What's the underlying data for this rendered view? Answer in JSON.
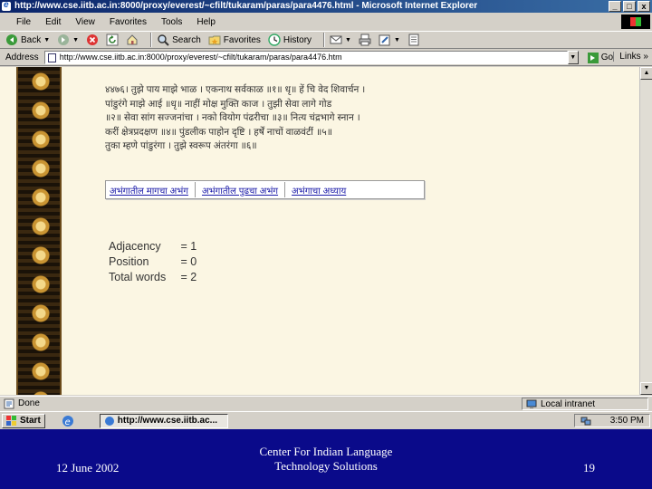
{
  "window": {
    "title": "http://www.cse.iitb.ac.in:8000/proxy/everest/~cfilt/tukaram/paras/para4476.html - Microsoft Internet Explorer",
    "minimize": "_",
    "maximize": "□",
    "close": "x"
  },
  "menu": [
    "File",
    "Edit",
    "View",
    "Favorites",
    "Tools",
    "Help"
  ],
  "toolbar": {
    "back": "Back",
    "search": "Search",
    "favorites": "Favorites",
    "history": "History"
  },
  "address": {
    "label": "Address",
    "url": "http://www.cse.iitb.ac.in:8000/proxy/everest/~cfilt/tukaram/paras/para4476.htm",
    "go": "Go",
    "links": "Links"
  },
  "content": {
    "gujarati_lines": [
      "४४७६। तुझे पाय माझे भाळ । एकनाथ सर्वकाळ ॥१॥ धृ॥ हें चि वेद शिवार्चन ।",
      "पांडुरंगे माझे आई ॥धृ॥ नाहीं मोक्ष मुक्ति काज । तुझी सेवा लागे गोड",
      "॥२॥ सेवा सांग सज्जनांचा । नको वियोग पंढरीचा ॥३॥ नित्य चंद्रभागे स्नान ।",
      "करीं क्षेत्रप्रदक्षण ॥४॥ पुंडलीक पाहोन दृष्टि । हर्षें नाचों वाळवंटीं ॥५॥",
      "तुका म्हणे पांडुरंगा । तुझे स्वरूप अंतरंगा ॥६॥"
    ],
    "links": [
      "अभंगातील मागचा अभंग",
      "अभंगातील पुढचा अभंग",
      "अभंगाचा अध्याय"
    ],
    "stats": [
      {
        "label": "Adjacency",
        "value": "= 1"
      },
      {
        "label": "Position",
        "value": "= 0"
      },
      {
        "label": "Total words",
        "value": "= 2"
      }
    ]
  },
  "status": {
    "text": "Done",
    "zone": "Local intranet"
  },
  "taskbar": {
    "start": "Start",
    "task": "http://www.cse.iitb.ac...",
    "clock": "3:50 PM"
  },
  "footer": {
    "date": "12 June 2002",
    "center_line1": "Center For Indian Language",
    "center_line2": "Technology Solutions",
    "page": "19"
  }
}
